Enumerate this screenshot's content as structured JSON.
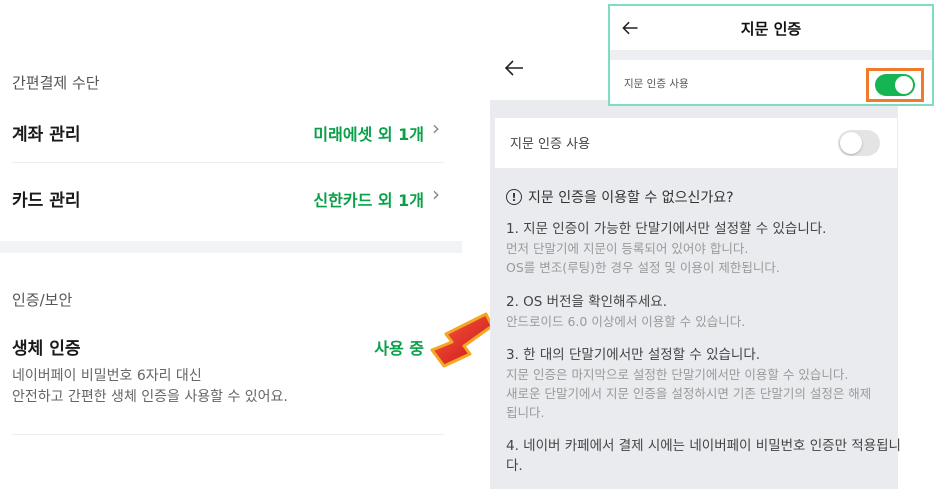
{
  "left": {
    "payment_section_title": "간편결제 수단",
    "account": {
      "label": "계좌 관리",
      "value": "미래에셋 외 1개"
    },
    "card": {
      "label": "카드 관리",
      "value": "신한카드 외 1개"
    },
    "auth_section_title": "인증/보안",
    "bio": {
      "label": "생체 인증",
      "status": "사용 중",
      "desc_line1": "네이버페이 비밀번호 6자리 대신",
      "desc_line2": "안전하고 간편한 생체 인증을 사용할 수 있어요."
    }
  },
  "right": {
    "toggle_label": "지문 인증 사용",
    "toggle_on": false,
    "info_icon": "exclamation-circle-icon",
    "info_title": "지문 인증을 이용할 수 없으신가요?",
    "step1": "1. 지문 인증이 가능한 단말기에서만 설정할 수 있습니다.",
    "step1_sub1": "먼저 단말기에 지문이 등록되어 있어야 합니다.",
    "step1_sub2": "OS를 변조(루팅)한 경우 설정 및 이용이 제한됩니다.",
    "step2": "2. OS 버전을 확인해주세요.",
    "step2_sub": "안드로이드 6.0 이상에서 이용할 수 있습니다.",
    "step3": "3. 한 대의 단말기에서만 설정할 수 있습니다.",
    "step3_sub1": "지문 인증은 마지막으로 설정한 단말기에서만 이용할 수 있습니다.",
    "step3_sub2": "새로운 단말기에서 지문 인증을 설정하시면 기존 단말기의 설정은 해제",
    "step3_sub3": "됩니다.",
    "step4_line1": "4. 네이버 카페에서 결제 시에는 네이버페이 비밀번호 인증만 적용됩니",
    "step4_line2": "다."
  },
  "inset": {
    "title": "지문 인증",
    "toggle_label": "지문 인증 사용",
    "toggle_on": true
  },
  "colors": {
    "accent_green": "#0aa04a",
    "toggle_green": "#17b552",
    "highlight_orange": "#f07a2a",
    "arrow_red": "#e8231b",
    "inset_border": "#7fdcc4"
  }
}
